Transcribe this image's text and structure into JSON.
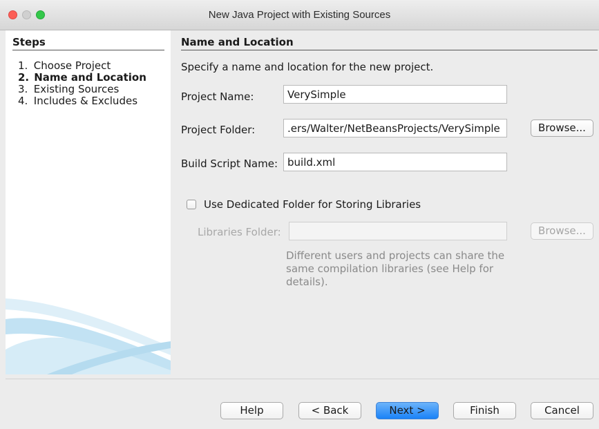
{
  "window": {
    "title": "New Java Project with Existing Sources"
  },
  "steps": {
    "heading": "Steps",
    "items": [
      {
        "num": "1.",
        "label": "Choose Project"
      },
      {
        "num": "2.",
        "label": "Name and Location",
        "current": true
      },
      {
        "num": "3.",
        "label": "Existing Sources"
      },
      {
        "num": "4.",
        "label": "Includes & Excludes"
      }
    ]
  },
  "panel": {
    "heading": "Name and Location",
    "instructions": "Specify a name and location for the new project.",
    "project_name": {
      "label": "Project Name:",
      "value": "VerySimple"
    },
    "project_folder": {
      "label": "Project Folder:",
      "value": ".ers/Walter/NetBeansProjects/VerySimple",
      "browse": "Browse..."
    },
    "build_script": {
      "label": "Build Script Name:",
      "value": "build.xml"
    },
    "dedicated_folder": {
      "label": "Use Dedicated Folder for Storing Libraries",
      "checked": false
    },
    "libraries_folder": {
      "label": "Libraries Folder:",
      "value": "",
      "browse": "Browse..."
    },
    "help_text": "Different users and projects can share the same compilation libraries (see Help for details)."
  },
  "buttons": {
    "help": "Help",
    "back": "< Back",
    "next": "Next >",
    "finish": "Finish",
    "cancel": "Cancel"
  },
  "colors": {
    "accent_button": "#1a82f7",
    "close": "#fc5f57",
    "maximize": "#34c84a"
  }
}
